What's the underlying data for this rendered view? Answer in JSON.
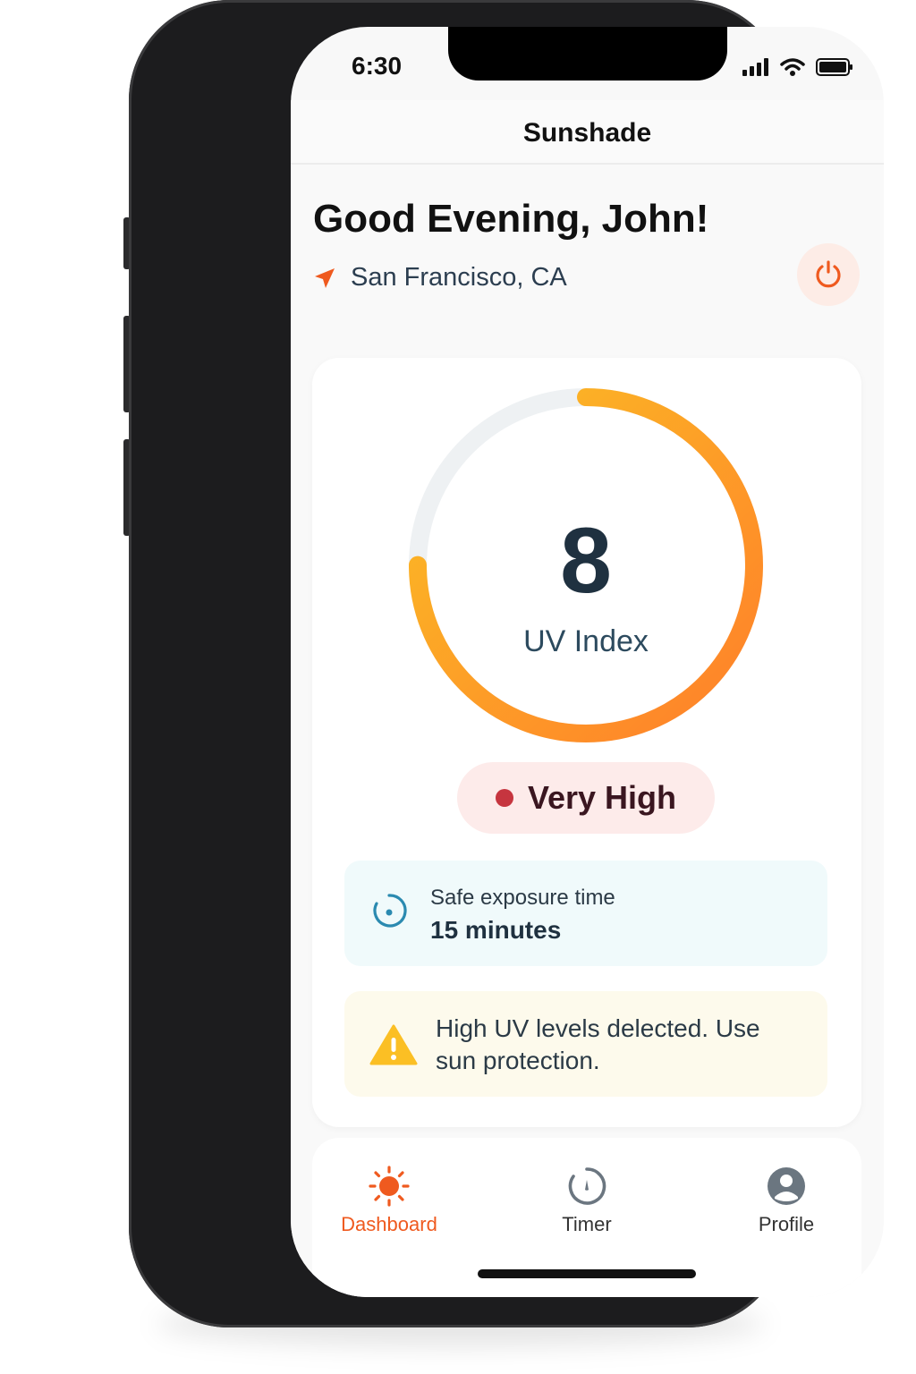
{
  "status_bar": {
    "time": "6:30"
  },
  "app": {
    "title": "Sunshade"
  },
  "greeting": "Good Evening, John!",
  "location": {
    "text": "San Francisco, CA",
    "icon": "location-arrow-icon"
  },
  "power_button": {
    "icon": "power-icon"
  },
  "uv": {
    "value": "8",
    "label": "UV Index",
    "level_fraction": 0.75,
    "risk": "Very High"
  },
  "exposure": {
    "title": "Safe exposure time",
    "value": "15 minutes",
    "icon": "timer-icon"
  },
  "warning": {
    "text": "High UV levels delected. Use sun protection.",
    "icon": "warning-icon"
  },
  "tabs": [
    {
      "label": "Dashboard",
      "icon": "sun-icon",
      "active": true
    },
    {
      "label": "Timer",
      "icon": "timer-icon",
      "active": false
    },
    {
      "label": "Profile",
      "icon": "user-icon",
      "active": false
    }
  ],
  "colors": {
    "accent": "#ef5a1f",
    "gauge_start": "#ff7f2a",
    "gauge_end": "#fbbf24",
    "risk_dot": "#c6353f"
  }
}
